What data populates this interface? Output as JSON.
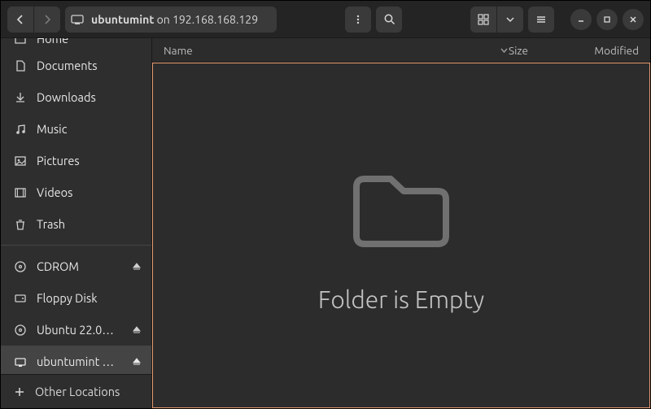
{
  "header": {
    "path_prefix": "ubuntumint",
    "path_on": "on",
    "path_host": "192.168.168.129"
  },
  "sidebar": {
    "items": [
      {
        "label": "Home",
        "icon": "home",
        "cut": true
      },
      {
        "label": "Documents",
        "icon": "documents"
      },
      {
        "label": "Downloads",
        "icon": "downloads"
      },
      {
        "label": "Music",
        "icon": "music"
      },
      {
        "label": "Pictures",
        "icon": "pictures"
      },
      {
        "label": "Videos",
        "icon": "videos"
      },
      {
        "label": "Trash",
        "icon": "trash"
      }
    ],
    "mounts": [
      {
        "label": "CDROM",
        "icon": "disc",
        "eject": true
      },
      {
        "label": "Floppy Disk",
        "icon": "drive",
        "eject": false
      },
      {
        "label": "Ubuntu 22.0…",
        "icon": "disc",
        "eject": true
      },
      {
        "label": "ubuntumint …",
        "icon": "network",
        "eject": true,
        "selected": true
      }
    ],
    "other": "Other Locations"
  },
  "columns": {
    "name": "Name",
    "size": "Size",
    "modified": "Modified"
  },
  "empty_message": "Folder is Empty"
}
